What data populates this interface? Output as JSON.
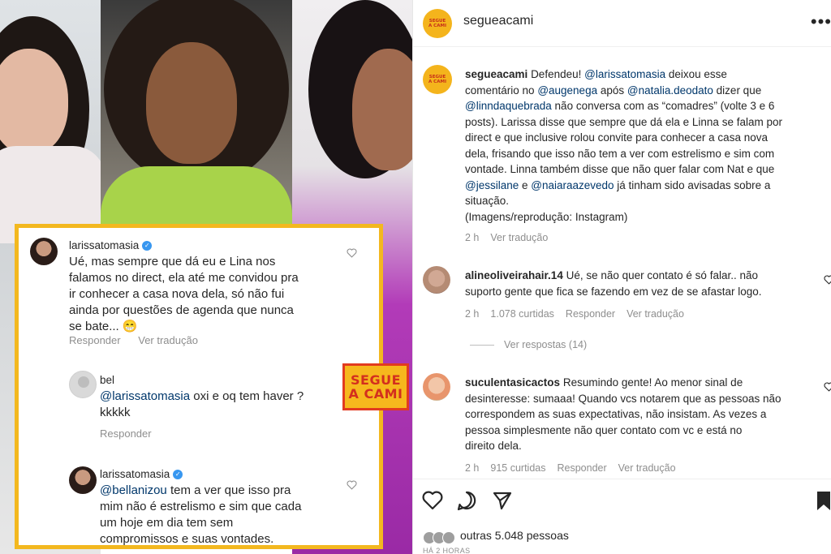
{
  "badge": {
    "line1": "SEGUE",
    "line2": "A CAMI"
  },
  "collage_comments": [
    {
      "user": "larissatomasia",
      "verified": true,
      "text_lines": [
        "Ué, mas sempre que dá eu e Lina nos",
        "falamos no direct, ela até me convidou pra",
        "ir conhecer a casa nova dela, só não fui",
        "ainda por questões de agenda que nunca",
        "se bate... 😁"
      ],
      "actions": [
        "Responder",
        "Ver tradução"
      ]
    },
    {
      "user": "bel",
      "mention": "@larissatomasia",
      "text_after_mention": " oxi e oq tem haver ?",
      "text_line2": "kkkkk",
      "actions": [
        "Responder"
      ]
    },
    {
      "user": "larissatomasia",
      "verified": true,
      "mention": "@bellanizou",
      "text_after_mention": " tem a ver que isso pra",
      "text_lines": [
        "mim não é estrelismo e sim que cada",
        "um hoje em dia tem sem",
        "compromissos e suas vontades."
      ]
    }
  ],
  "ig": {
    "header_user": "segueacami",
    "more_label": "•••",
    "caption": {
      "user": "segueacami",
      "lines": [
        [
          "Defendeu! ",
          "@larissatomasia",
          " deixou esse"
        ],
        [
          "comentário no ",
          "@augenega",
          " após ",
          "@natalia.deodato",
          " dizer que"
        ],
        [
          "@linndaquebrada",
          " não conversa com as “comadres” (volte 3 e 6"
        ],
        [
          "posts). Larissa disse que sempre que dá ela e Linna se falam por"
        ],
        [
          "direct e que inclusive rolou convite para conhecer a casa nova"
        ],
        [
          "dela, frisando que isso não tem a ver com estrelismo e sim com"
        ],
        [
          "vontade. Linna também disse que não quer falar com Nat e que"
        ],
        [
          "@jessilane",
          " e ",
          "@naiaraazevedo",
          " já tinham sido avisadas sobre a"
        ],
        [
          "situação."
        ],
        [
          "(Imagens/reprodução: Instagram)"
        ]
      ],
      "time": "2 h",
      "translate": "Ver tradução"
    },
    "comments": [
      {
        "user": "alineoliveirahair.14",
        "text_line1": " Ué, se não quer contato é só falar.. não",
        "text_line2": "suporto gente que fica se fazendo em vez de se afastar logo.",
        "time": "2 h",
        "likes": "1.078 curtidas",
        "reply": "Responder",
        "translate": "Ver tradução",
        "view_replies": "Ver respostas (14)"
      },
      {
        "user": "suculentasicactos",
        "text_line1": " Resumindo gente! Ao menor sinal de",
        "lines": [
          "desinteresse: sumaaa! Quando vcs notarem que as pessoas não",
          "correspondem as suas expectativas, não insistam. As vezes a",
          "pessoa simplesmente não quer contato com vc e está no",
          "direito dela."
        ],
        "time": "2 h",
        "likes": "915 curtidas",
        "reply": "Responder",
        "translate": "Ver tradução"
      }
    ],
    "liked_by": "outras 5.048 pessoas",
    "time_ago": "HÁ 2 HORAS"
  }
}
